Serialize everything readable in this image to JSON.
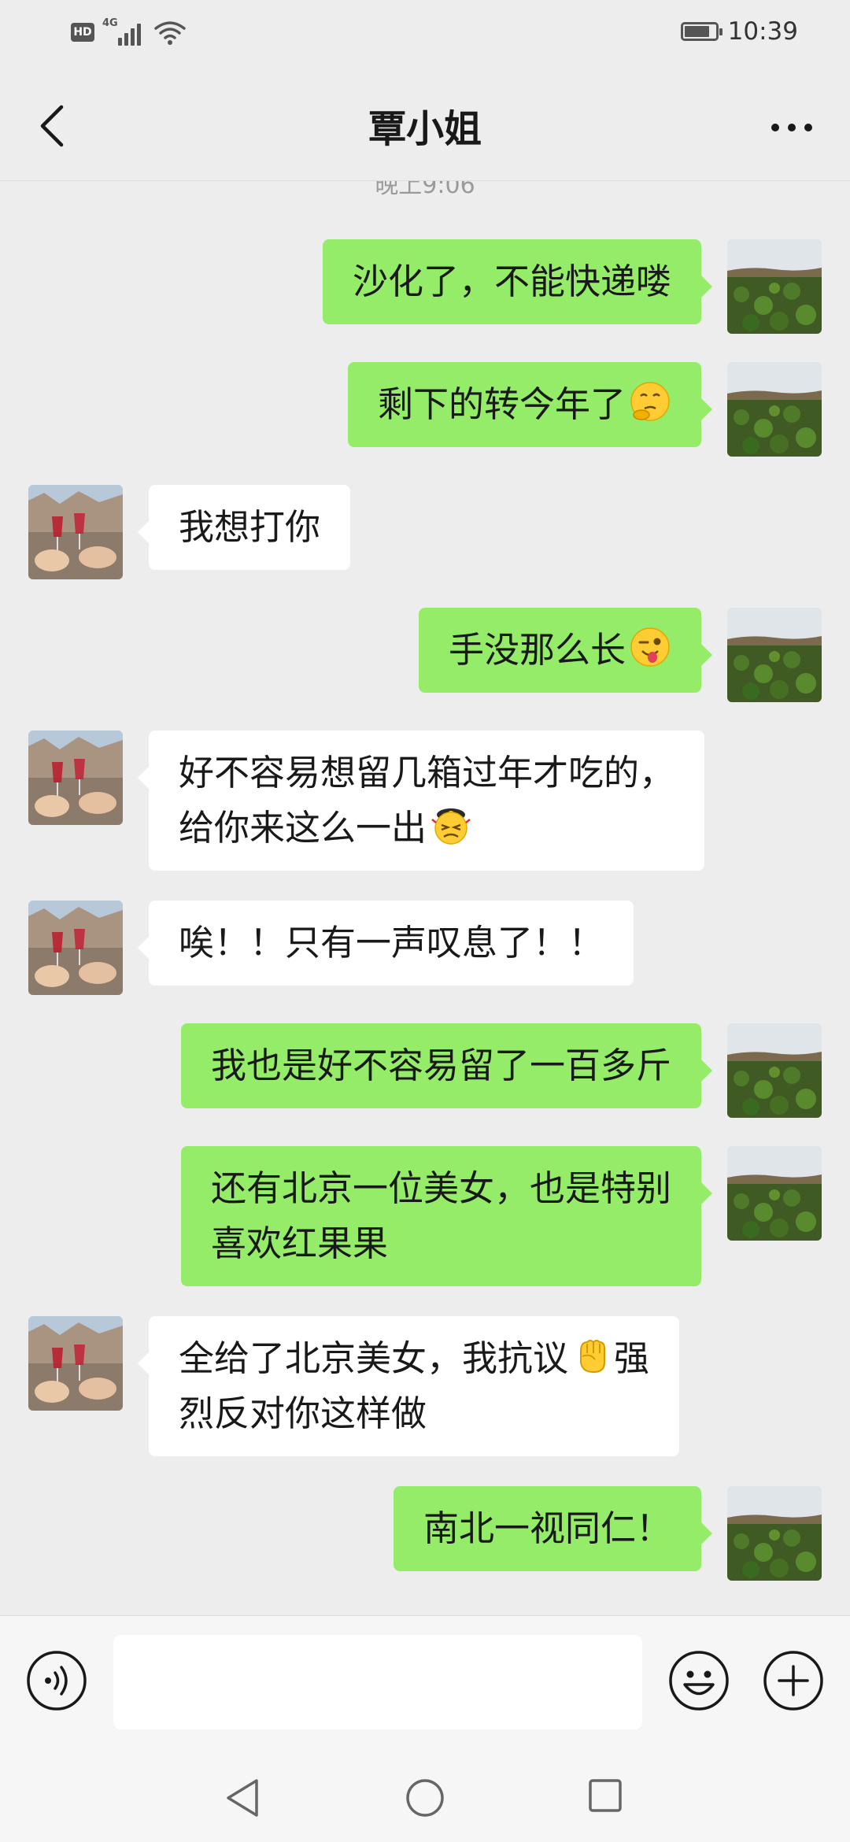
{
  "status_bar": {
    "time": "10:39",
    "hd_label": "HD",
    "network": "4G",
    "battery_level": 0.75
  },
  "header": {
    "title": "覃小姐"
  },
  "chat": {
    "timestamp": "晚上9:06",
    "messages": [
      {
        "side": "right",
        "lines": [
          "沙化了，不能快递喽"
        ]
      },
      {
        "side": "right",
        "lines": [
          "剩下的转今年了"
        ],
        "emoji": "thinking-face"
      },
      {
        "side": "left",
        "lines": [
          "我想打你"
        ]
      },
      {
        "side": "right",
        "lines": [
          "手没那么长"
        ],
        "emoji": "winking-tongue-face"
      },
      {
        "side": "left",
        "lines": [
          "好不容易想留几箱过年才吃的，",
          "给你来这么一出"
        ],
        "emoji": "frustrated-face"
      },
      {
        "side": "left",
        "lines": [
          "唉！！只有一声叹息了！！"
        ]
      },
      {
        "side": "right",
        "lines": [
          "我也是好不容易留了一百多斤"
        ]
      },
      {
        "side": "right",
        "lines": [
          "还有北京一位美女，也是特别",
          "喜欢红果果"
        ]
      },
      {
        "side": "left",
        "lines": [
          "全给了北京美女，我抗议",
          "烈反对你这样做"
        ],
        "inline_emoji": "raised-fist",
        "after_emoji": "强"
      },
      {
        "side": "right",
        "lines": [
          "南北一视同仁！"
        ]
      }
    ]
  },
  "input": {
    "value": "",
    "placeholder": ""
  },
  "colors": {
    "sent_bubble": "#95ec69",
    "received_bubble": "#ffffff",
    "background": "#ededed"
  }
}
